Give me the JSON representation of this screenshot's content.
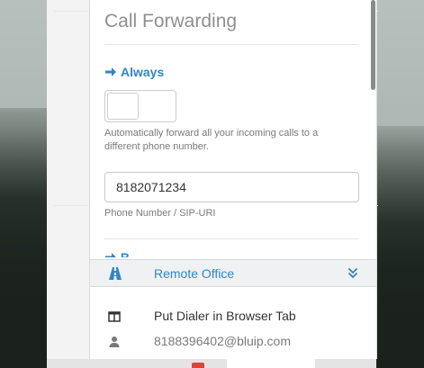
{
  "panel": {
    "title": "Call Forwarding",
    "section_always": "Always",
    "always_toggle_on": false,
    "description": "Automatically forward all your incoming calls to a different phone number.",
    "phone_value": "8182071234",
    "phone_label": "Phone Number / SIP-URI",
    "next_section_partial": "B"
  },
  "remote_office": {
    "label": "Remote Office",
    "icon": "road-icon",
    "expand_icon": "double-chevron-down-icon"
  },
  "menu": {
    "dialer_label": "Put Dialer in Browser Tab",
    "dialer_icon": "columns-icon",
    "user_label": "8188396402@bluip.com",
    "user_icon": "user-icon"
  },
  "colors": {
    "accent": "#2f86c6",
    "title": "#8f8f8f",
    "muted": "#7a7a7a"
  }
}
